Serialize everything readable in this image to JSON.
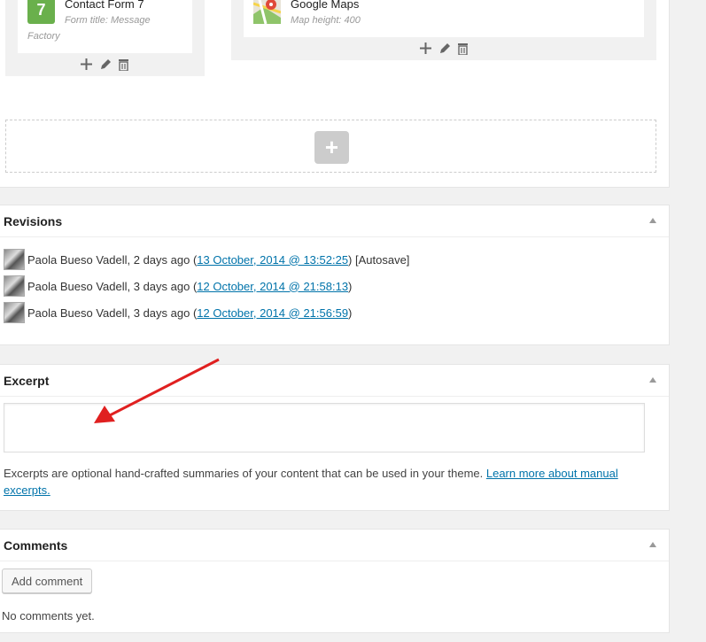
{
  "builder": {
    "widgets": [
      {
        "icon": "contact-form-7-icon",
        "icon_text": "7",
        "title": "Contact Form 7",
        "subtitle": "Form title: Message Factory",
        "subtitle_line1": "Form title: Message",
        "subtitle_line2": "Factory"
      },
      {
        "icon": "google-maps-icon",
        "title": "Google Maps",
        "subtitle": "Map height: 400"
      }
    ],
    "add_symbol": "+",
    "add_row_symbol": "+"
  },
  "revisions": {
    "title": "Revisions",
    "items": [
      {
        "author": "Paola Bueso Vadell, 2 days ago (",
        "date": "13 October, 2014 @ 13:52:25",
        "suffix": ") [Autosave]"
      },
      {
        "author": "Paola Bueso Vadell, 3 days ago (",
        "date": "12 October, 2014 @ 21:58:13",
        "suffix": ")"
      },
      {
        "author": "Paola Bueso Vadell, 3 days ago (",
        "date": "12 October, 2014 @ 21:56:59",
        "suffix": ")"
      }
    ]
  },
  "excerpt": {
    "title": "Excerpt",
    "value": "",
    "help_text": "Excerpts are optional hand-crafted summaries of your content that can be used in your theme. ",
    "help_link": "Learn more about manual excerpts."
  },
  "comments": {
    "title": "Comments",
    "add_button": "Add comment",
    "empty_text": "No comments yet."
  },
  "colors": {
    "link": "#0073aa",
    "annotation_arrow": "#e02020",
    "cf7_green": "#6ab04c"
  }
}
